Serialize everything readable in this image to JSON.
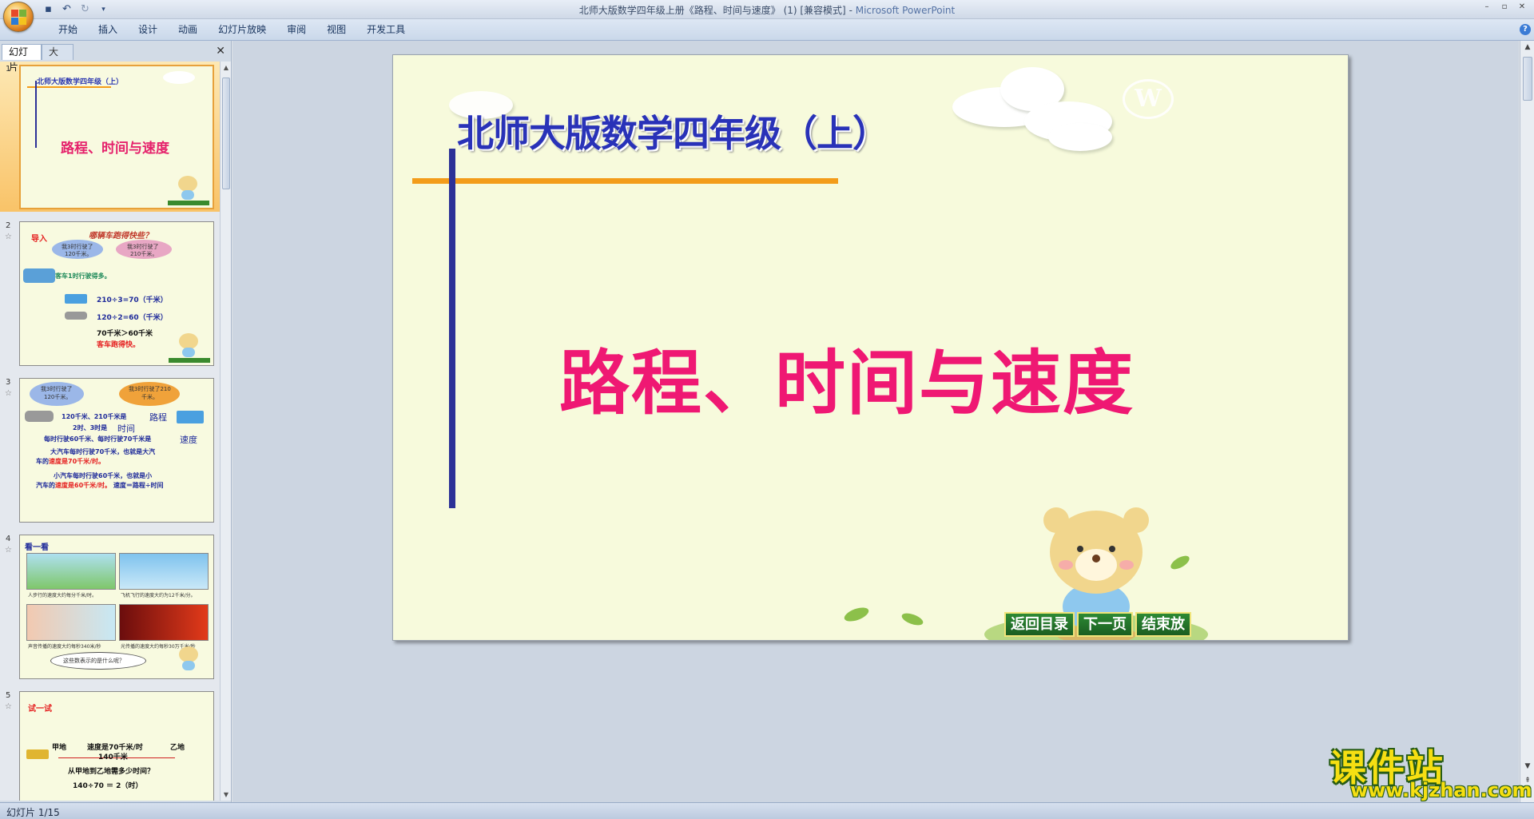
{
  "window": {
    "title": "北师大版数学四年级上册《路程、时间与速度》 (1) [兼容模式]",
    "app_name": "Microsoft PowerPoint"
  },
  "ribbon": {
    "tabs": [
      "开始",
      "插入",
      "设计",
      "动画",
      "幻灯片放映",
      "审阅",
      "视图",
      "开发工具"
    ]
  },
  "left_panel": {
    "tabs": [
      "幻灯片",
      "大纲"
    ],
    "thumbnails": [
      {
        "num": "1",
        "title": "北师大版数学四年级（上）",
        "main": "路程、时间与速度"
      },
      {
        "num": "2",
        "label": "导入",
        "heading": "哪辆车跑得快些？",
        "bubble_a": "我3时行驶了",
        "bubble_a2": "120千米。",
        "bubble_b": "我3时行驶了",
        "bubble_b2": "210千米。",
        "line1": "客车1时行驶得多。",
        "line2": "210÷3=70（千米）",
        "line3": "120÷2=60（千米）",
        "line4": "70千米＞60千米",
        "line5": "客车跑得快。"
      },
      {
        "num": "3",
        "bubble_a": "我3时行驶了",
        "bubble_a2": "120千米。",
        "bubble_b": "我3时行驶了210",
        "bubble_b2": "千米。",
        "line1": "120千米、210千米是",
        "side1": "路程",
        "line2": "2时、3时是",
        "side2": "时间",
        "line3": "每时行驶60千米、每时行驶70千米是",
        "side3": "速度",
        "line4": "大汽车每时行驶70千米，也就是大汽",
        "line5a": "车的",
        "line5b": "速度是70千米/时。",
        "line6": "小汽车每时行驶60千米，也就是小",
        "line7a": "汽车的",
        "line7b": "速度是60千米/时。",
        "line7c": "速度＝路程÷时间"
      },
      {
        "num": "4",
        "heading": "看一看",
        "cap1": "人步行的速度大约每分千米/时。",
        "cap2": "飞机飞行的速度大约为12千米/分。",
        "cap3": "声音传播的速度大约每秒340米/秒",
        "cap4": "光传播的速度大约每秒30万千米/秒",
        "bubble": "这些数表示的是什么呢？"
      },
      {
        "num": "5",
        "heading": "试一试",
        "place_a": "甲地",
        "speed": "速度是70千米/时",
        "place_b": "乙地",
        "distance": "140千米",
        "question": "从甲地到乙地需多少时间？",
        "answer": "140÷70 ＝ 2（时）"
      }
    ]
  },
  "slide": {
    "series_title": "北师大版数学四年级（上）",
    "main_title": "路程、时间与速度",
    "nav_buttons": [
      "返回目录",
      "下一页",
      "结束放"
    ]
  },
  "status_bar": {
    "text": "幻灯片 1/15"
  },
  "watermark": {
    "chinese": "课件站",
    "url": "www.kjzhan.com"
  },
  "colors": {
    "slide_bg": "#f7fadc",
    "title_blue": "#2932b8",
    "main_pink": "#ef1873",
    "accent_orange": "#f39c1a",
    "nav_green": "#2d8a34"
  }
}
